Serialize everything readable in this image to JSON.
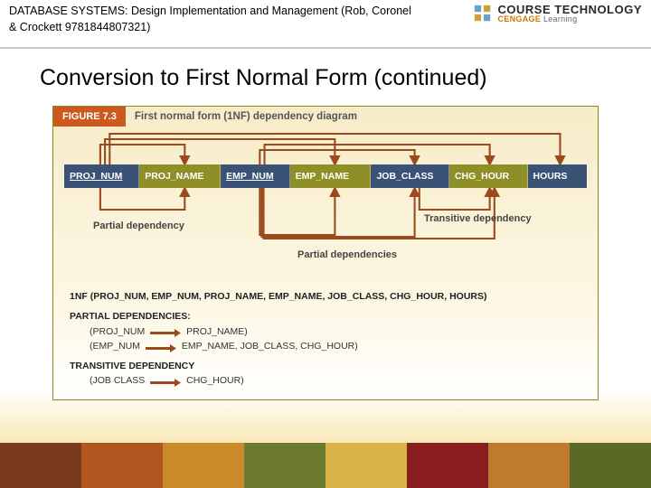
{
  "header": {
    "book_ref": "DATABASE SYSTEMS: Design Implementation and Management (Rob, Coronel & Crockett 9781844807321)",
    "brand_line1": "COURSE TECHNOLOGY",
    "brand_line2_a": "CENGAGE",
    "brand_line2_b": " Learning"
  },
  "title": "Conversion to First Normal Form (continued)",
  "figure": {
    "badge": "FIGURE 7.3",
    "caption": "First normal form (1NF) dependency diagram",
    "columns": [
      "PROJ_NUM",
      "PROJ_NAME",
      "EMP_NUM",
      "EMP_NAME",
      "JOB_CLASS",
      "CHG_HOUR",
      "HOURS"
    ],
    "label_partial1": "Partial dependency",
    "label_transitive": "Transitive dependency",
    "label_partial2": "Partial dependencies"
  },
  "notes": {
    "nf_line": "1NF (PROJ_NUM, EMP_NUM, PROJ_NAME, EMP_NAME, JOB_CLASS, CHG_HOUR, HOURS)",
    "partial_title": "PARTIAL DEPENDENCIES:",
    "partial_line1_left": "(PROJ_NUM",
    "partial_line1_right": "PROJ_NAME)",
    "partial_line2_left": "(EMP_NUM",
    "partial_line2_right": "EMP_NAME, JOB_CLASS, CHG_HOUR)",
    "transitive_title": "TRANSITIVE DEPENDENCY",
    "transitive_left": "(JOB CLASS",
    "transitive_right": "CHG_HOUR)"
  }
}
